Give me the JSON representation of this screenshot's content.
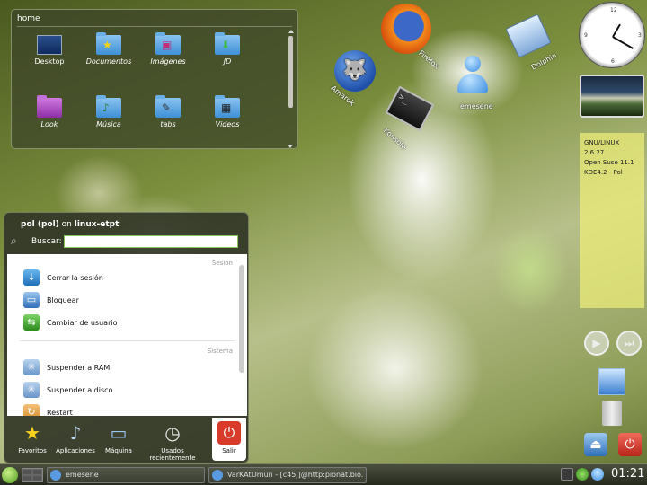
{
  "folderview": {
    "title": "home",
    "items": [
      {
        "label": "Desktop",
        "icon": "desktop-icon"
      },
      {
        "label": "Documentos",
        "icon": "folder-star-icon"
      },
      {
        "label": "Imágenes",
        "icon": "folder-images-icon"
      },
      {
        "label": "JD",
        "icon": "folder-download-icon"
      },
      {
        "label": "Look",
        "icon": "folder-look-icon"
      },
      {
        "label": "Música",
        "icon": "folder-music-icon"
      },
      {
        "label": "tabs",
        "icon": "folder-tabs-icon"
      },
      {
        "label": "Videos",
        "icon": "folder-videos-icon"
      }
    ]
  },
  "desktop_icons": {
    "firefox": "Firefox",
    "amarok": "Amarok",
    "konsole": "Konsole",
    "emesene": "emesene",
    "dolphin": "Dolphin"
  },
  "note": {
    "line1": "GNU/LINUX 2.6.27",
    "line2": "Open Suse 11.1",
    "line3": "KDE4.2 - Pol"
  },
  "kickoff": {
    "user_name": "pol (pol)",
    "on": "on",
    "host": "linux-etpt",
    "search_label": "Buscar:",
    "search_value": "",
    "section_session": "Sesión",
    "section_system": "Sistema",
    "items": {
      "logout": "Cerrar la sesión",
      "lock": "Bloquear",
      "switch_user": "Cambiar de usuario",
      "suspend_ram": "Suspender a RAM",
      "suspend_disk": "Suspender a disco",
      "restart": "Restart"
    },
    "tabs": {
      "favorites": "Favoritos",
      "applications": "Aplicaciones",
      "computer": "Máquina",
      "recent": "Usados recientemente",
      "leave": "Salir"
    }
  },
  "taskbar": {
    "task1": "emesene",
    "task2": "VarKAtDmun - [c45j]@http:pionat.bio.",
    "clock": "01:21"
  },
  "colors": {
    "accent_green": "#86c65a",
    "leave_red": "#d93b2b"
  }
}
